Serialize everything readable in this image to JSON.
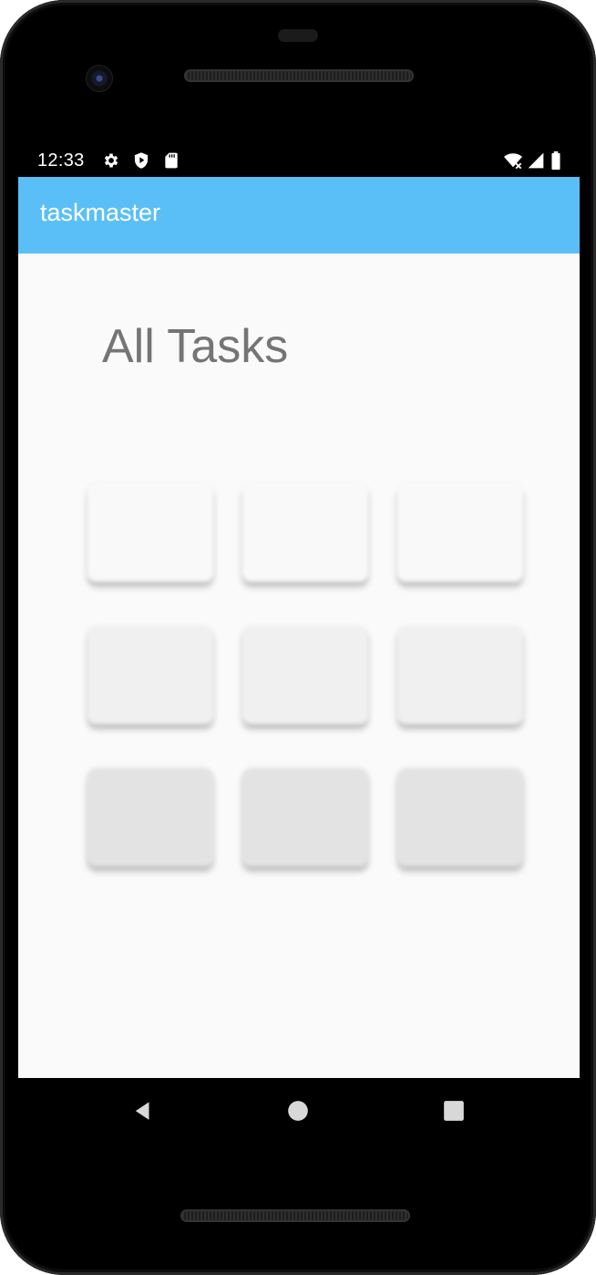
{
  "status_bar": {
    "time": "12:33",
    "left_icons": [
      "settings-gear-icon",
      "play-protect-shield-icon",
      "sd-card-icon"
    ],
    "right_icons": [
      "wifi-off-icon",
      "cell-signal-icon",
      "battery-icon"
    ]
  },
  "app_bar": {
    "title": "taskmaster",
    "color": "#5bbff7"
  },
  "main": {
    "heading": "All Tasks",
    "task_placeholders": {
      "rows": 3,
      "columns": 3,
      "state": "loading",
      "row_colors": [
        "#f9f9f9",
        "#f0f0f0",
        "#e3e3e3"
      ]
    }
  },
  "navigation": {
    "buttons": [
      {
        "name": "back",
        "icon": "back-triangle-icon"
      },
      {
        "name": "home",
        "icon": "home-circle-icon"
      },
      {
        "name": "recents",
        "icon": "recents-square-icon"
      }
    ]
  }
}
